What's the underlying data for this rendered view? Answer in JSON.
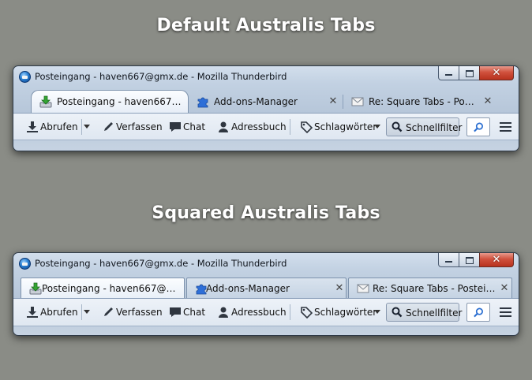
{
  "headings": {
    "default": "Default Australis Tabs",
    "squared": "Squared Australis Tabs"
  },
  "window": {
    "title": "Posteingang - haven667@gmx.de - Mozilla Thunderbird",
    "close_label": "✕"
  },
  "tabs_default": [
    {
      "label": "Posteingang - haven667@g...",
      "icon": "inbox-download-icon",
      "selected": true
    },
    {
      "label": "Add-ons-Manager",
      "icon": "puzzle-piece-icon",
      "selected": false,
      "close": "✕"
    },
    {
      "label": "Re: Square Tabs - Postei...",
      "icon": "envelope-icon",
      "selected": false,
      "close": "✕"
    }
  ],
  "tabs_squared": [
    {
      "label": "Posteingang - haven667@gmx....",
      "icon": "inbox-download-icon",
      "selected": true
    },
    {
      "label": "Add-ons-Manager",
      "icon": "puzzle-piece-icon",
      "selected": false,
      "close": "✕"
    },
    {
      "label": "Re: Square Tabs - Posteinga...",
      "icon": "envelope-icon",
      "selected": false,
      "close": "✕"
    }
  ],
  "toolbar": {
    "get_messages": "Abrufen",
    "write": "Verfassen",
    "chat": "Chat",
    "address_book": "Adressbuch",
    "tags": "Schlagwörter",
    "quick_filter": "Schnellfilter"
  },
  "colors": {
    "background": "#8a8c86",
    "close_button": "#c84a35"
  }
}
